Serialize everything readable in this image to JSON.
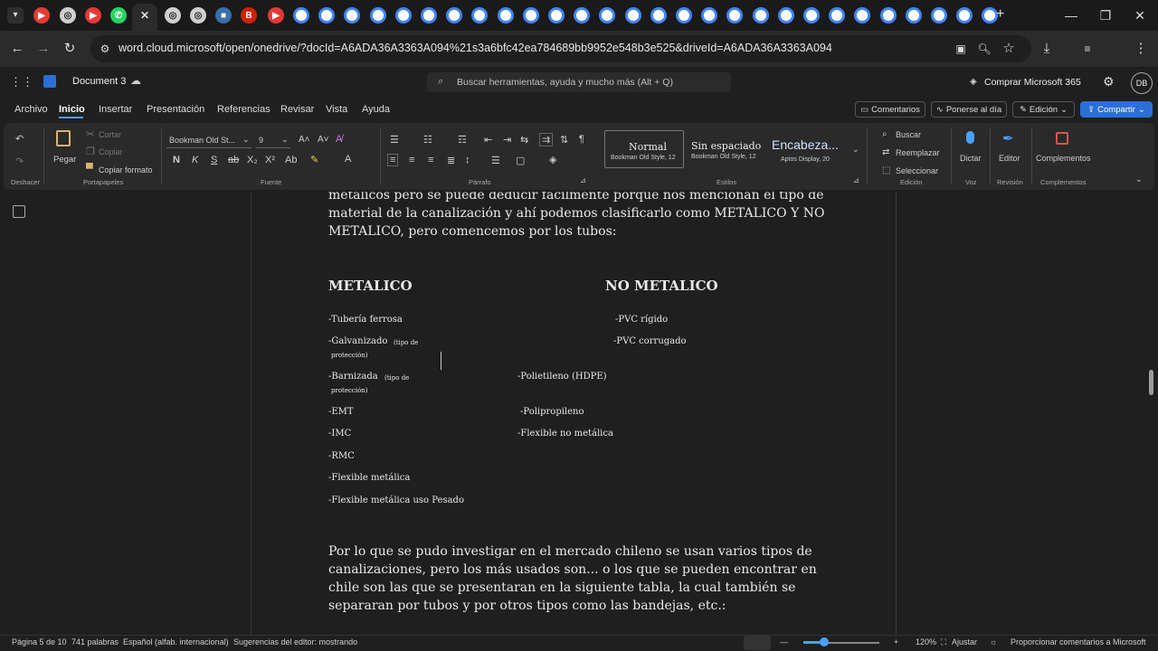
{
  "browser": {
    "url": "word.cloud.microsoft/open/onedrive/?docId=A6ADA36A3363A094%21s3a6bfc42ea784689bb9952e548b3e525&driveId=A6ADA36A3363A094",
    "colors": {
      "tabbar": "#1a1a1a",
      "toolbar": "#2b2b2b"
    }
  },
  "word": {
    "doc_name": "Document 3",
    "search_placeholder": "Buscar herramientas, ayuda y mucho más (Alt + Q)",
    "buy_label": "Comprar Microsoft 365",
    "avatar": "DB",
    "menu": [
      "Archivo",
      "Inicio",
      "Insertar",
      "Presentación",
      "Referencias",
      "Revisar",
      "Vista",
      "Ayuda"
    ],
    "comments_btn": "Comentarios",
    "catchup_btn": "Ponerse al día",
    "edit_btn": "Edición",
    "share_btn": "Compartir",
    "accent": "#2b6fd6"
  },
  "ribbon": {
    "undo_group": "Deshacer",
    "paste": "Pegar",
    "cut": "Cortar",
    "copy": "Copiar",
    "format_painter": "Copiar formato",
    "clipboard_group": "Portapapeles",
    "font_name": "Bookman Old St...",
    "font_size": "9",
    "font_group": "Fuente",
    "paragraph_group": "Párrafo",
    "styles": [
      {
        "name": "Normal",
        "sub": "Bookman Old Style, 12"
      },
      {
        "name": "Sin espaciado",
        "sub": "Bookman Old Style, 12"
      },
      {
        "name": "Encabeza...",
        "sub": "Aptos Display, 20"
      }
    ],
    "styles_group": "Estilos",
    "find": "Buscar",
    "replace": "Reemplazar",
    "select": "Seleccionar",
    "edit_group": "Edición",
    "dictate": "Dictar",
    "voice_group": "Voz",
    "editor": "Editor",
    "review_group": "Revisión",
    "addins": "Complementos",
    "addins_group": "Complementos"
  },
  "document": {
    "intro_lines": [
      "metálicos pero se puede deducir fácilmente porque nos mencionan el tipo de",
      "material de la canalización y ahí podemos clasificarlo como METALICO Y NO",
      "METALICO, pero comencemos por los tubos:"
    ],
    "metal_header": "METALICO",
    "nonmetal_header": "NO METALICO",
    "metal_items": [
      "-Tubería ferrosa",
      "-Galvanizado",
      "-Barnizada",
      "-EMT",
      "-IMC",
      "-RMC",
      "-Flexible metálica",
      "-Flexible metálica uso Pesado"
    ],
    "metal_notes": {
      "galv_note_1": "(tipo de",
      "galv_note_2": "protección)",
      "barn_note_1": "(tipo de",
      "barn_note_2": "protección)"
    },
    "nonmetal_items": [
      "-PVC rígido",
      "-PVC corrugado",
      "-Polietileno (HDPE)",
      "-Polipropileno",
      "-Flexible no metálica"
    ],
    "closing_lines": [
      "Por lo que se pudo investigar en el mercado chileno se usan varios tipos de",
      "canalizaciones, pero los más usados son... o los que se pueden encontrar en",
      "chile son las que se presentaran en la siguiente tabla, la cual también se",
      "separaran por tubos y por otros tipos como las bandejas, etc.:"
    ]
  },
  "status": {
    "page": "Página 5 de 10",
    "words": "741 palabras",
    "language": "Español (alfab. internacional)",
    "suggestions": "Sugerencias del editor: mostrando",
    "zoom": "120%",
    "fit": "Ajustar",
    "feedback": "Proporcionar comentarios a Microsoft"
  }
}
